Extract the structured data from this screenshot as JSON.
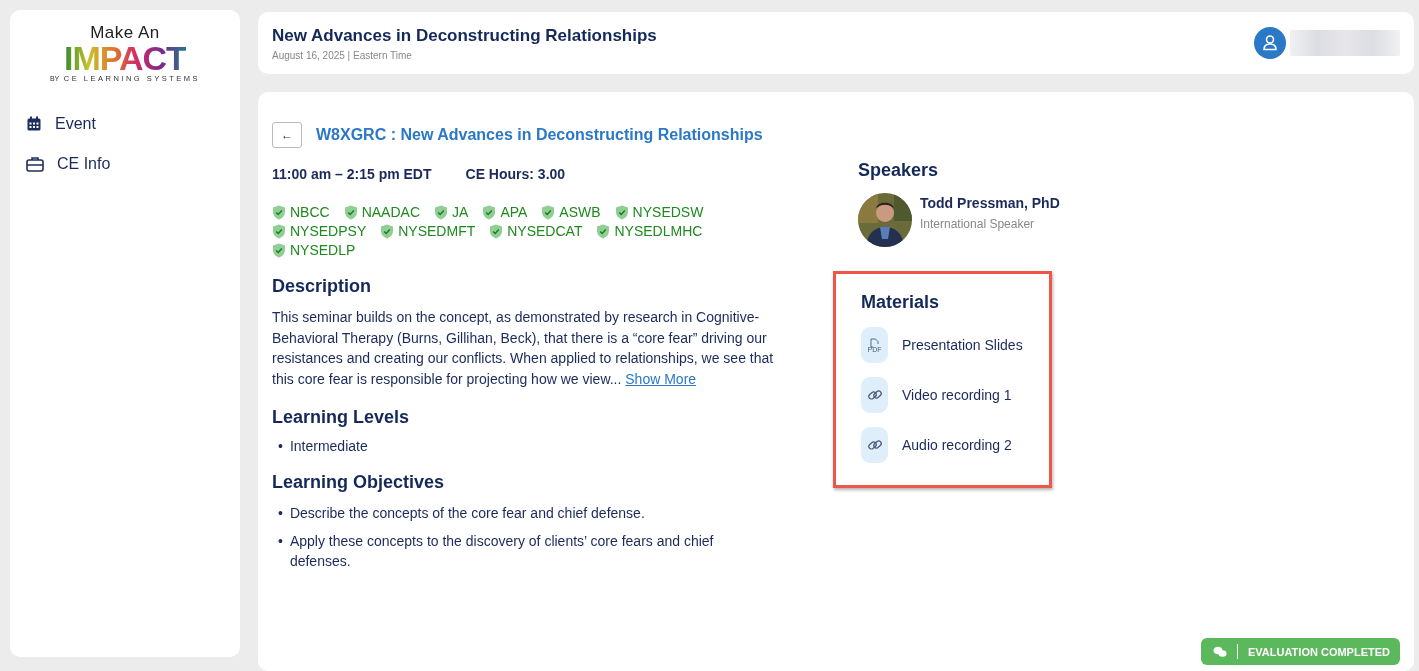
{
  "logo": {
    "line_1": "Make An",
    "line_2": "IMPACT",
    "by": "BY",
    "company": "CE LEARNING SYSTEMS"
  },
  "sidebar": {
    "items": [
      {
        "label": "Event",
        "selected": false
      },
      {
        "label": "CE Info",
        "selected": false
      }
    ]
  },
  "header": {
    "title": "New Advances in Deconstructing Relationships",
    "subtitle": "August 16, 2025 | Eastern Time"
  },
  "event": {
    "back": "←",
    "title": "W8XGRC : New Advances in Deconstructing Relationships",
    "time": "11:00 am – 2:15 pm EDT",
    "ce_hours": "CE Hours: 3.00",
    "approvals": [
      "NBCC",
      "NAADAC",
      "JA",
      "APA",
      "ASWB",
      "NYSEDSW",
      "NYSEDPSY",
      "NYSEDMFT",
      "NYSEDCAT",
      "NYSEDLMHC",
      "NYSEDLP"
    ],
    "description_heading": "Description",
    "description": "This seminar builds on the concept, as demonstrated by research in Cognitive-Behavioral Therapy (Burns, Gillihan, Beck), that there is a “core fear” driving our resistances and creating our conflicts. When applied to relationships, we see that this core fear is responsible for projecting how we view...",
    "show_more": "Show More",
    "bullet": "•",
    "levels_heading": "Learning Levels",
    "levels": [
      "Intermediate"
    ],
    "objectives_heading": "Learning Objectives",
    "objectives": [
      "Describe the concepts of the core fear and chief defense.",
      "Apply these concepts to the discovery of clients’ core fears and chief defenses."
    ]
  },
  "speakers": {
    "heading": "Speakers",
    "items": [
      {
        "name": "Todd Pressman, PhD",
        "role": "International Speaker"
      }
    ]
  },
  "materials": {
    "heading": "Materials",
    "highlighted": true,
    "items": [
      {
        "label": "Presentation Slides",
        "kind": "pdf",
        "icon_text": "PDF"
      },
      {
        "label": "Video recording 1",
        "kind": "link"
      },
      {
        "label": "Audio recording 2",
        "kind": "link"
      }
    ]
  },
  "evaluation_button": {
    "label": "EVALUATION COMPLETED"
  }
}
